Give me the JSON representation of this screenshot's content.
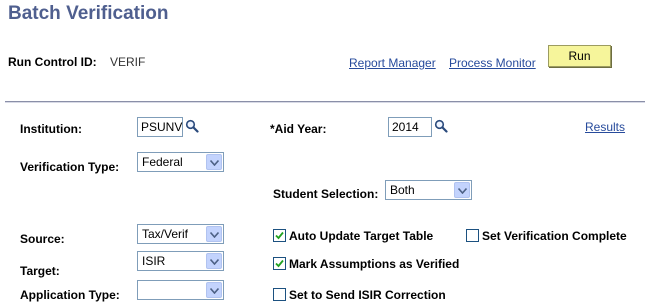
{
  "page": {
    "title": "Batch Verification"
  },
  "run_control": {
    "label": "Run Control ID:",
    "value": "VERIF"
  },
  "links": {
    "report_manager": "Report Manager",
    "process_monitor": "Process Monitor",
    "results": "Results"
  },
  "run_button": "Run",
  "form": {
    "institution": {
      "label": "Institution:",
      "value": "PSUNV"
    },
    "aid_year": {
      "label": "*Aid Year:",
      "value": "2014"
    },
    "verification_type": {
      "label": "Verification Type:",
      "value": "Federal"
    },
    "student_selection": {
      "label": "Student Selection:",
      "value": "Both"
    },
    "source": {
      "label": "Source:",
      "value": "Tax/Verif"
    },
    "target": {
      "label": "Target:",
      "value": "ISIR"
    },
    "application_type": {
      "label": "Application Type:",
      "value": ""
    }
  },
  "checkboxes": {
    "auto_update": {
      "label": "Auto Update Target Table",
      "checked": true
    },
    "set_verification_complete": {
      "label": "Set Verification Complete",
      "checked": false
    },
    "mark_assumptions": {
      "label": "Mark Assumptions as Verified",
      "checked": true
    },
    "send_isir": {
      "label": "Set to Send ISIR Correction",
      "checked": false
    }
  },
  "icons": {
    "lookup": "magnifier-icon",
    "dropdown": "dropdown-arrow-icon",
    "check": "check-icon"
  },
  "colors": {
    "title": "#4f5f8f",
    "link": "#274b9c",
    "run_button": "#f6f59b"
  }
}
